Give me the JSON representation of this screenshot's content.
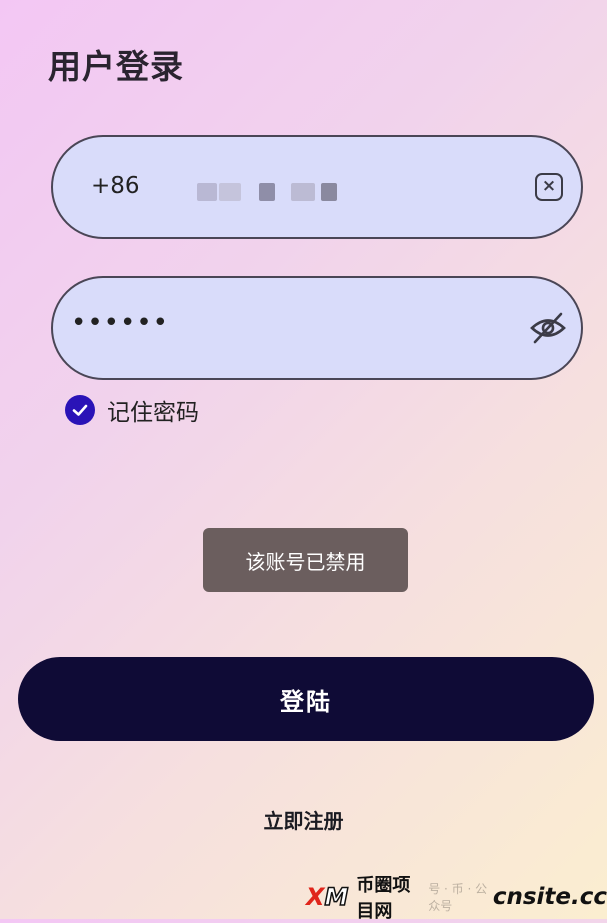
{
  "page": {
    "title": "用户登录"
  },
  "phone_field": {
    "country_code": "+86",
    "clear_icon": "clear-icon"
  },
  "password_field": {
    "value": "••••••",
    "visibility_icon": "eye-off-icon"
  },
  "remember": {
    "label": "记住密码",
    "checked": true,
    "color": "#2a13b7"
  },
  "toast": {
    "message": "该账号已禁用"
  },
  "login_button": {
    "label": "登陆",
    "color": "#0f0b36"
  },
  "register_link": {
    "label": "立即注册"
  },
  "watermark": {
    "logo_x": "X",
    "logo_m": "M",
    "cn_text": "币圈项目网",
    "faint_text": "号 · 币 · 公众号",
    "site": "cnsite.cc"
  }
}
